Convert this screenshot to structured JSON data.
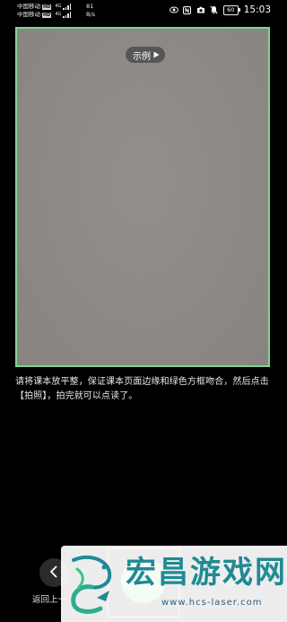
{
  "status_bar": {
    "carrier_1": "中国移动",
    "carrier_2": "中国移动",
    "hd_badge": "HD",
    "net_type": "4G",
    "speed_value": "81",
    "speed_unit": "B/s",
    "battery": "60",
    "time": "15:03"
  },
  "camera": {
    "sample_label": "示例",
    "instruction": "请将课本放平整，保证课本页面边缘和绿色方框吻合，然后点击【拍照】，拍完就可以点读了。",
    "frame_color": "#7ed692",
    "shutter_color": "#5fd07e",
    "highlight_color": "#e2394b"
  },
  "bottom_bar": {
    "back_label": "返回上一"
  },
  "watermark": {
    "title": "宏昌游戏网",
    "url": "www.hcs-laser.com"
  }
}
